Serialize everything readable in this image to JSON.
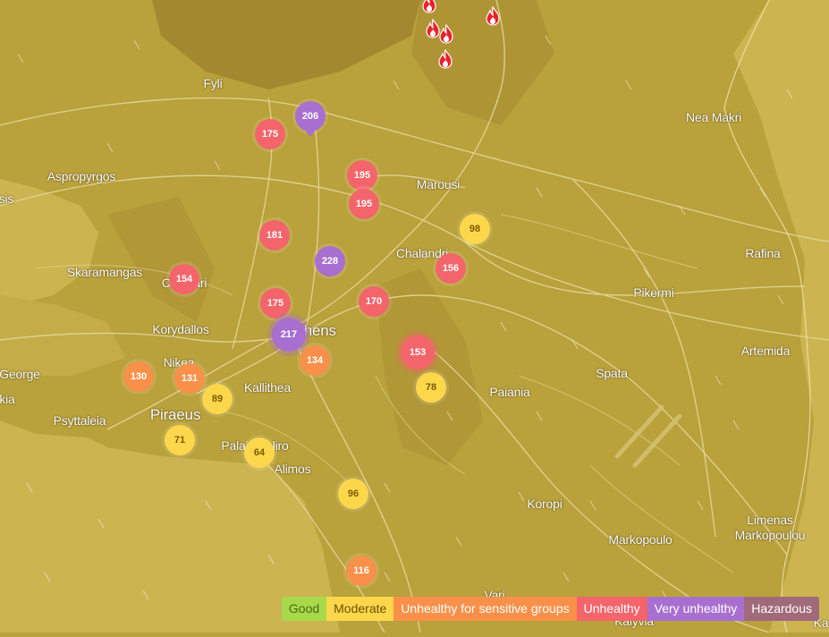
{
  "places": [
    {
      "name": "Fyli"
    },
    {
      "name": "Nea Makri"
    },
    {
      "name": "Aspropyrgos"
    },
    {
      "name": "sis"
    },
    {
      "name": "Marousi"
    },
    {
      "name": "Chalandri"
    },
    {
      "name": "Rafina"
    },
    {
      "name": "Skaramangas"
    },
    {
      "name": "Chaidari"
    },
    {
      "name": "Pikermi"
    },
    {
      "name": "Korydallos"
    },
    {
      "name": "Athens"
    },
    {
      "name": "Artemida"
    },
    {
      "name": "Nikea"
    },
    {
      "name": "George"
    },
    {
      "name": "Kallithea"
    },
    {
      "name": "Spata"
    },
    {
      "name": "Paiania"
    },
    {
      "name": "kia"
    },
    {
      "name": "Piraeus"
    },
    {
      "name": "Psyttaleia"
    },
    {
      "name": "Palaio Faliro"
    },
    {
      "name": "Alimos"
    },
    {
      "name": "Koropi"
    },
    {
      "name": "Markopoulo"
    },
    {
      "name": "Limenas Markopoulou"
    },
    {
      "name": "Vari"
    },
    {
      "name": "Kalyvia"
    },
    {
      "name": "Ka"
    }
  ],
  "stations": [
    {
      "aqi": "206",
      "color": "#a86fd0",
      "text": "#ffffff",
      "pin": true
    },
    {
      "aqi": "175",
      "color": "#f4646b",
      "text": "#ffffff"
    },
    {
      "aqi": "195",
      "color": "#f4646b",
      "text": "#ffffff"
    },
    {
      "aqi": "195",
      "color": "#f4646b",
      "text": "#ffffff"
    },
    {
      "aqi": "98",
      "color": "#fdd74b",
      "text": "#7a5a00"
    },
    {
      "aqi": "181",
      "color": "#f4646b",
      "text": "#ffffff"
    },
    {
      "aqi": "228",
      "color": "#a86fd0",
      "text": "#ffffff"
    },
    {
      "aqi": "156",
      "color": "#f4646b",
      "text": "#ffffff"
    },
    {
      "aqi": "154",
      "color": "#f4646b",
      "text": "#ffffff"
    },
    {
      "aqi": "175",
      "color": "#f4646b",
      "text": "#ffffff"
    },
    {
      "aqi": "170",
      "color": "#f4646b",
      "text": "#ffffff"
    },
    {
      "aqi": "217",
      "color": "#a86fd0",
      "text": "#ffffff"
    },
    {
      "aqi": "134",
      "color": "#f99049",
      "text": "#ffffff"
    },
    {
      "aqi": "153",
      "color": "#f4646b",
      "text": "#ffffff"
    },
    {
      "aqi": "130",
      "color": "#f99049",
      "text": "#ffffff"
    },
    {
      "aqi": "131",
      "color": "#f99049",
      "text": "#ffffff"
    },
    {
      "aqi": "89",
      "color": "#fdd74b",
      "text": "#7a5a00"
    },
    {
      "aqi": "78",
      "color": "#fdd74b",
      "text": "#7a5a00"
    },
    {
      "aqi": "71",
      "color": "#fdd74b",
      "text": "#7a5a00"
    },
    {
      "aqi": "64",
      "color": "#fdd74b",
      "text": "#7a5a00"
    },
    {
      "aqi": "96",
      "color": "#fdd74b",
      "text": "#7a5a00"
    },
    {
      "aqi": "116",
      "color": "#f99049",
      "text": "#ffffff"
    }
  ],
  "fire_icon": "flame-icon",
  "legend": [
    {
      "label": "Good",
      "color": "#a8d94b",
      "text": "#4a6a10"
    },
    {
      "label": "Moderate",
      "color": "#fdd74b",
      "text": "#6a5000"
    },
    {
      "label": "Unhealthy for sensitive groups",
      "color": "#f99049",
      "text": "#ffffff"
    },
    {
      "label": "Unhealthy",
      "color": "#f4646b",
      "text": "#ffffff"
    },
    {
      "label": "Very unhealthy",
      "color": "#a86fd0",
      "text": "#ffffff"
    },
    {
      "label": "Hazardous",
      "color": "#a06a7b",
      "text": "#ffffff"
    }
  ],
  "colors": {
    "land": "#b8a03a",
    "sea": "#cdb551",
    "mountain": "#9a8028"
  }
}
